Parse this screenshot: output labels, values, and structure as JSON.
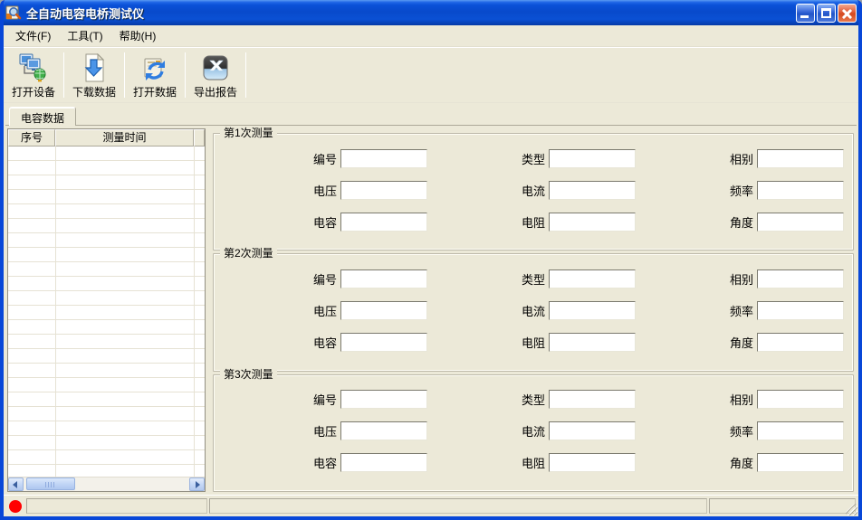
{
  "window": {
    "title": "全自动电容电桥测试仪"
  },
  "menu": {
    "items": [
      "文件(F)",
      "工具(T)",
      "帮助(H)"
    ]
  },
  "toolbar": {
    "buttons": [
      {
        "label": "打开设备",
        "icon": "open-device-icon"
      },
      {
        "label": "下载数据",
        "icon": "download-data-icon"
      },
      {
        "label": "打开数据",
        "icon": "open-data-icon"
      },
      {
        "label": "导出报告",
        "icon": "export-report-icon"
      }
    ]
  },
  "tab": {
    "label": "电容数据"
  },
  "table": {
    "columns": [
      "序号",
      "测量时间"
    ]
  },
  "groups": [
    {
      "title": "第1次测量",
      "fields": [
        {
          "label": "编号",
          "value": ""
        },
        {
          "label": "类型",
          "value": ""
        },
        {
          "label": "相别",
          "value": ""
        },
        {
          "label": "电压",
          "value": ""
        },
        {
          "label": "电流",
          "value": ""
        },
        {
          "label": "频率",
          "value": ""
        },
        {
          "label": "电容",
          "value": ""
        },
        {
          "label": "电阻",
          "value": ""
        },
        {
          "label": "角度",
          "value": ""
        }
      ]
    },
    {
      "title": "第2次测量",
      "fields": [
        {
          "label": "编号",
          "value": ""
        },
        {
          "label": "类型",
          "value": ""
        },
        {
          "label": "相别",
          "value": ""
        },
        {
          "label": "电压",
          "value": ""
        },
        {
          "label": "电流",
          "value": ""
        },
        {
          "label": "频率",
          "value": ""
        },
        {
          "label": "电容",
          "value": ""
        },
        {
          "label": "电阻",
          "value": ""
        },
        {
          "label": "角度",
          "value": ""
        }
      ]
    },
    {
      "title": "第3次测量",
      "fields": [
        {
          "label": "编号",
          "value": ""
        },
        {
          "label": "类型",
          "value": ""
        },
        {
          "label": "相别",
          "value": ""
        },
        {
          "label": "电压",
          "value": ""
        },
        {
          "label": "电流",
          "value": ""
        },
        {
          "label": "频率",
          "value": ""
        },
        {
          "label": "电容",
          "value": ""
        },
        {
          "label": "电阻",
          "value": ""
        },
        {
          "label": "角度",
          "value": ""
        }
      ]
    }
  ],
  "statusbar": {
    "panels": [
      "",
      "",
      ""
    ],
    "indicator_color": "#ff0000"
  },
  "colors": {
    "titlebar_blue": "#0847d8",
    "window_bg": "#ece9d8",
    "status_red": "#ff0000"
  }
}
